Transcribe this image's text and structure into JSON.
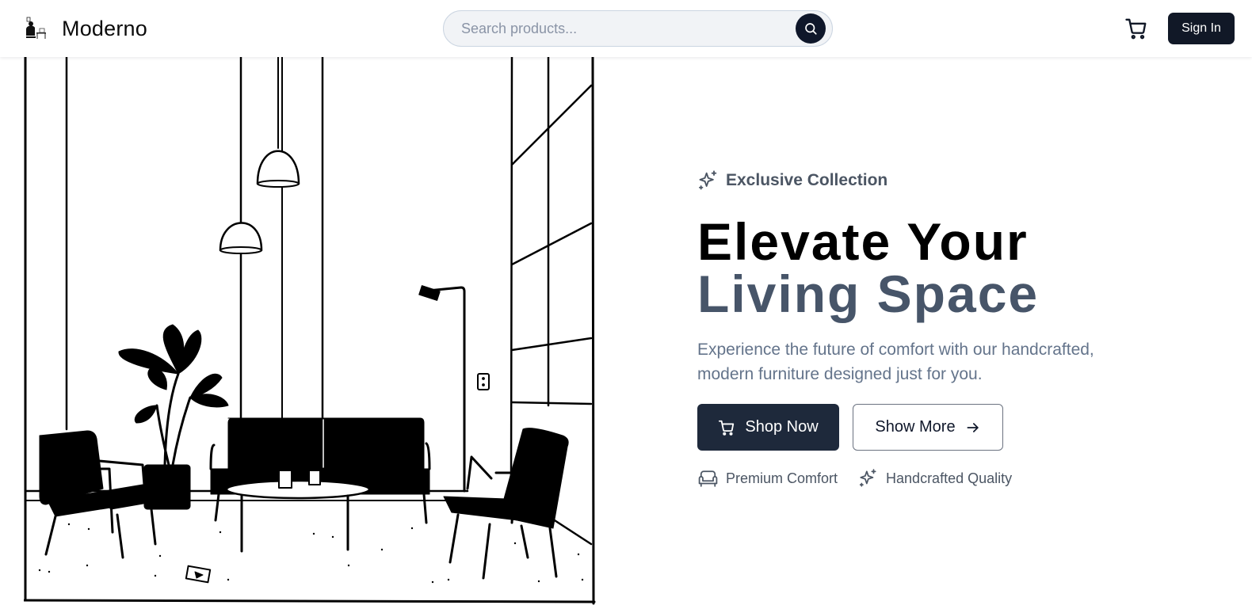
{
  "brand": {
    "name": "Moderno",
    "logo_icon": "home-office-illustration-logo"
  },
  "search": {
    "placeholder": "Search products...",
    "value": "",
    "button_icon": "search-icon"
  },
  "header": {
    "cart_icon": "cart-icon",
    "signin_label": "Sign In"
  },
  "hero": {
    "image": "living-room-line-illustration",
    "eyebrow_icon": "sparkles-icon",
    "eyebrow": "Exclusive Collection",
    "headline_line1": "Elevate Your",
    "headline_line2": "Living Space",
    "subtitle": "Experience the future of comfort with our handcrafted, modern furniture designed just for you.",
    "primary_cta": {
      "label": "Shop Now",
      "icon": "cart-icon"
    },
    "secondary_cta": {
      "label": "Show More",
      "icon": "arrow-right-icon"
    },
    "features": [
      {
        "label": "Premium Comfort",
        "icon": "sofa-icon"
      },
      {
        "label": "Handcrafted Quality",
        "icon": "sparkles-icon"
      }
    ]
  },
  "colors": {
    "primary_dark": "#1e293b",
    "signin_bg": "#111827",
    "headline_accent": "#475569",
    "muted_text": "#64748b",
    "search_bg": "#f1f3f6"
  }
}
